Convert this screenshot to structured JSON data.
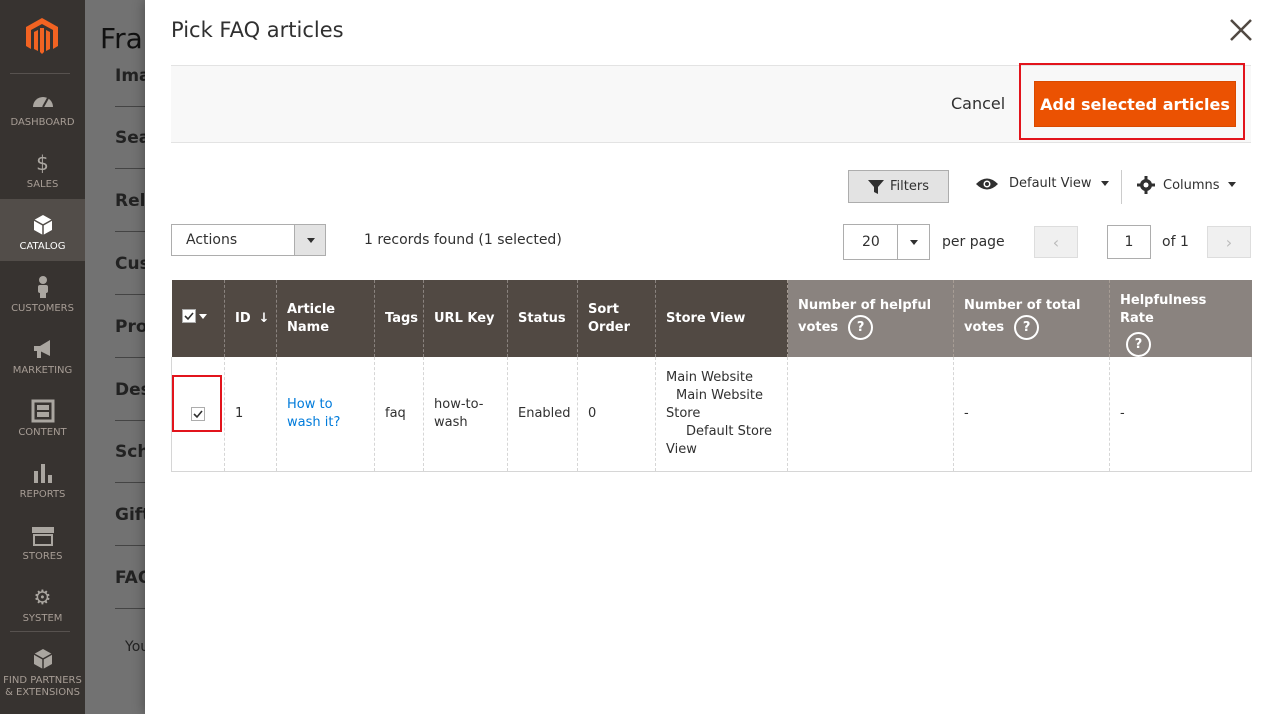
{
  "sidebar": {
    "items": [
      {
        "label": "DASHBOARD",
        "icon": "dashboard-icon"
      },
      {
        "label": "SALES",
        "icon": "dollar-icon"
      },
      {
        "label": "CATALOG",
        "icon": "box-icon"
      },
      {
        "label": "CUSTOMERS",
        "icon": "person-icon"
      },
      {
        "label": "MARKETING",
        "icon": "megaphone-icon"
      },
      {
        "label": "CONTENT",
        "icon": "layout-icon"
      },
      {
        "label": "REPORTS",
        "icon": "bar-chart-icon"
      },
      {
        "label": "STORES",
        "icon": "storefront-icon"
      },
      {
        "label": "SYSTEM",
        "icon": "gear-icon"
      },
      {
        "label1": "FIND PARTNERS",
        "label2": "& EXTENSIONS",
        "icon": "extensions-icon"
      }
    ]
  },
  "background": {
    "title": "Fran",
    "sections": [
      "Ima",
      "Sea",
      "Rela",
      "Cus",
      "Pro",
      "Des",
      "Sch",
      "Gift",
      "FAQ"
    ],
    "footer_text": "You"
  },
  "modal": {
    "title": "Pick FAQ articles",
    "cancel_label": "Cancel",
    "add_label": "Add selected articles"
  },
  "toolbar": {
    "filters_label": "Filters",
    "view_label": "Default View",
    "columns_label": "Columns",
    "actions_label": "Actions",
    "records_text": "1 records found (1 selected)",
    "per_page_value": "20",
    "per_page_label": "per page",
    "page_value": "1",
    "page_total": "of 1"
  },
  "table": {
    "headers": {
      "id": "ID",
      "name_1": "Article",
      "name_2": "Name",
      "tags": "Tags",
      "url": "URL Key",
      "status": "Status",
      "sort_1": "Sort",
      "sort_2": "Order",
      "store": "Store View",
      "helpful_1": "Number of helpful",
      "helpful_2": "votes",
      "total_1": "Number of total",
      "total_2": "votes",
      "rate": "Helpfulness Rate",
      "help_mark": "?"
    },
    "row": {
      "id": "1",
      "name_1": "How to",
      "name_2": "wash it?",
      "tags": "faq",
      "url_1": "how-to-",
      "url_2": "wash",
      "status": "Enabled",
      "sort": "0",
      "store_1": "Main Website",
      "store_2": "Main Website",
      "store_3": "Store",
      "store_4": "Default Store",
      "store_5": "View",
      "helpful": "",
      "total": "-",
      "rate": "-",
      "checked": true
    }
  },
  "colors": {
    "accent": "#eb5202",
    "header_dark": "#514943",
    "header_light": "#8a837f",
    "sidebar": "#373330",
    "highlight": "#e2141c",
    "link": "#007bdb"
  }
}
